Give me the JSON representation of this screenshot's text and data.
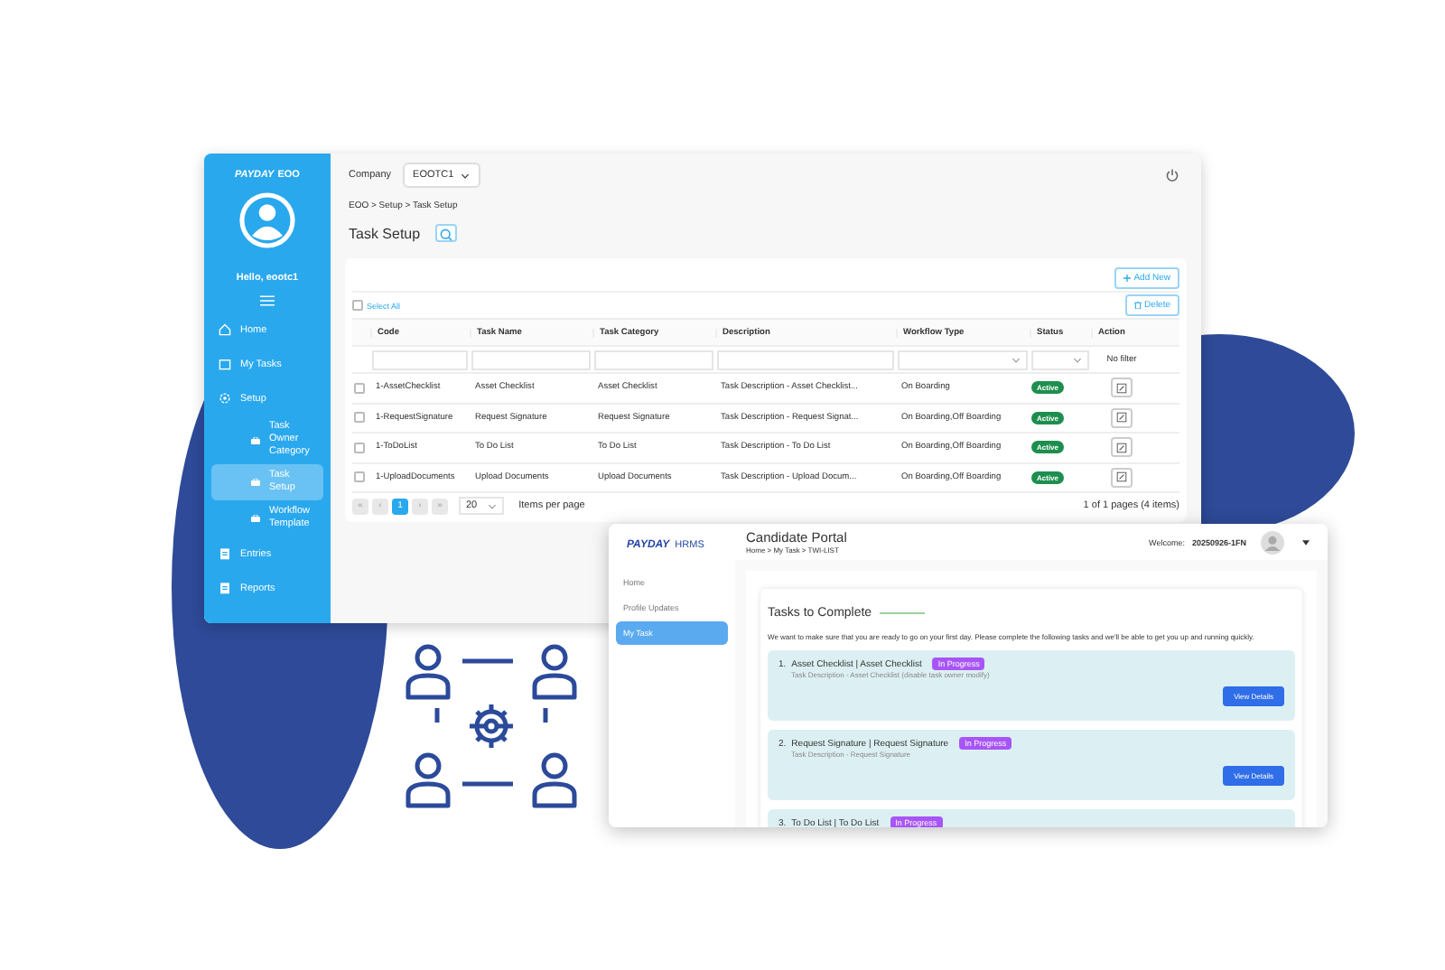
{
  "admin_window": {
    "logo": "PAYDAY",
    "logo_suffix": "EOO",
    "greeting": "Hello, eootc1",
    "sidebar": {
      "items": [
        {
          "label": "Home",
          "selected": false
        },
        {
          "label": "My Tasks",
          "selected": false
        },
        {
          "label": "Setup",
          "selected": false,
          "children": [
            {
              "label": "Task Owner Category",
              "selected": false
            },
            {
              "label": "Task Setup",
              "selected": true
            },
            {
              "label": "Workflow Template",
              "selected": false
            }
          ]
        },
        {
          "label": "Entries",
          "selected": false
        },
        {
          "label": "Reports",
          "selected": false
        }
      ]
    },
    "company_label": "Company",
    "company_value": "EOOTC1",
    "breadcrumb": "EOO > Setup > Task Setup",
    "title": "Task Setup",
    "add_button": "Add New",
    "delete_button": "Delete",
    "select_all": {
      "label": "Select All",
      "checked": false
    },
    "table": {
      "columns": [
        "Code",
        "Task Name",
        "Task Category",
        "Description",
        "Workflow Type",
        "Status",
        "Action"
      ],
      "action_filter": "No filter",
      "rows": [
        {
          "checked": false,
          "cells": [
            "1-AssetChecklist",
            "Asset Checklist",
            "Asset Checklist",
            "Task Description - Asset Checklist...",
            "On Boarding"
          ],
          "status": "Active"
        },
        {
          "checked": false,
          "cells": [
            "1-RequestSignature",
            "Request Signature",
            "Request Signature",
            "Task Description - Request Signat...",
            "On Boarding,Off Boarding"
          ],
          "status": "Active"
        },
        {
          "checked": false,
          "cells": [
            "1-ToDoList",
            "To Do List",
            "To Do List",
            "Task Description - To Do List",
            "On Boarding,Off Boarding"
          ],
          "status": "Active"
        },
        {
          "checked": false,
          "cells": [
            "1-UploadDocuments",
            "Upload Documents",
            "Upload Documents",
            "Task Description - Upload Docum...",
            "On Boarding,Off Boarding"
          ],
          "status": "Active"
        }
      ]
    },
    "pager": {
      "buttons": [
        {
          "label": "«",
          "selected": false
        },
        {
          "label": "‹",
          "selected": false
        },
        {
          "label": "1",
          "selected": true
        },
        {
          "label": "›",
          "selected": false
        },
        {
          "label": "»",
          "selected": false
        }
      ],
      "page_size": "20",
      "page_size_label": "Items per page",
      "summary": "1 of 1 pages (4 items)"
    }
  },
  "portal_window": {
    "logo": "PAYDAY",
    "logo_suffix": "HRMS",
    "nav": [
      {
        "label": "Home",
        "selected": false
      },
      {
        "label": "Profile Updates",
        "selected": false
      },
      {
        "label": "My Task",
        "selected": true
      }
    ],
    "title": "Candidate Portal",
    "breadcrumb": "Home > My Task > TWI-LIST",
    "welcome_label": "Welcome:",
    "user": "20250926-1FN",
    "heading": "Tasks to Complete",
    "intro": "We want to make sure that you are ready to go on your first day. Please complete the following tasks and we'll be able to get you up and running quickly.",
    "tasks": [
      {
        "number": "1.",
        "title": "Asset Checklist | Asset Checklist",
        "badge": "In Progress",
        "description": "Task Description - Asset Checklist (disable task owner modify)",
        "button": "View Details"
      },
      {
        "number": "2.",
        "title": "Request Signature | Request Signature",
        "badge": "In Progress",
        "description": "Task Description - Request Signature",
        "button": "View Details"
      },
      {
        "number": "3.",
        "title": "To Do List | To Do List",
        "badge": "In Progress"
      }
    ]
  }
}
